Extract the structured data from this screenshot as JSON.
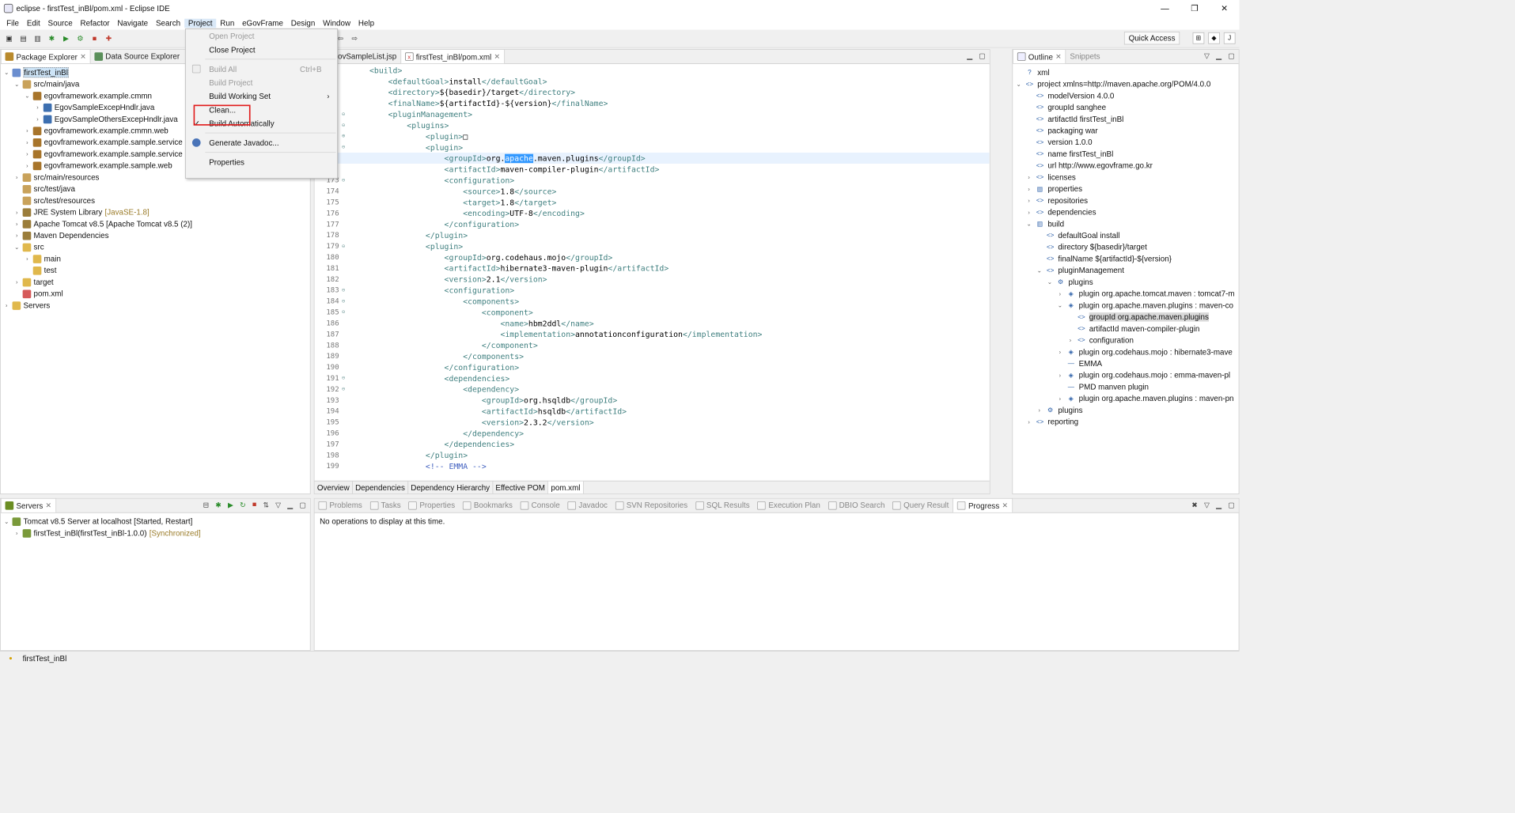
{
  "window": {
    "title": "eclipse - firstTest_inBl/pom.xml - Eclipse IDE",
    "controls": [
      "—",
      "❐",
      "✕"
    ]
  },
  "menubar": [
    "File",
    "Edit",
    "Source",
    "Refactor",
    "Navigate",
    "Search",
    "Project",
    "Run",
    "eGovFrame",
    "Design",
    "Window",
    "Help"
  ],
  "toolbar": {
    "quick_access": "Quick Access"
  },
  "package_explorer": {
    "tabs": [
      "Package Explorer",
      "Data Source Explorer"
    ],
    "tree": [
      {
        "label": "firstTest_inBl",
        "deco": "",
        "indent": 0,
        "twisty": "v",
        "icon": "project-icon",
        "selected": true
      },
      {
        "label": "src/main/java",
        "deco": "",
        "indent": 1,
        "twisty": "v",
        "icon": "source-folder-icon"
      },
      {
        "label": "egovframework.example.cmmn",
        "deco": "",
        "indent": 2,
        "twisty": "v",
        "icon": "package-icon"
      },
      {
        "label": "EgovSampleExcepHndlr.java",
        "deco": "",
        "indent": 3,
        "twisty": ">",
        "icon": "java-file-icon"
      },
      {
        "label": "EgovSampleOthersExcepHndlr.java",
        "deco": "",
        "indent": 3,
        "twisty": ">",
        "icon": "java-file-icon"
      },
      {
        "label": "egovframework.example.cmmn.web",
        "deco": "",
        "indent": 2,
        "twisty": ">",
        "icon": "package-icon"
      },
      {
        "label": "egovframework.example.sample.service",
        "deco": "",
        "indent": 2,
        "twisty": ">",
        "icon": "package-icon"
      },
      {
        "label": "egovframework.example.sample.service",
        "deco": "",
        "indent": 2,
        "twisty": ">",
        "icon": "package-icon"
      },
      {
        "label": "egovframework.example.sample.web",
        "deco": "",
        "indent": 2,
        "twisty": ">",
        "icon": "package-icon"
      },
      {
        "label": "src/main/resources",
        "deco": "",
        "indent": 1,
        "twisty": ">",
        "icon": "source-folder-icon"
      },
      {
        "label": "src/test/java",
        "deco": "",
        "indent": 1,
        "twisty": "",
        "icon": "source-folder-icon"
      },
      {
        "label": "src/test/resources",
        "deco": "",
        "indent": 1,
        "twisty": "",
        "icon": "source-folder-icon"
      },
      {
        "label": "JRE System Library",
        "deco": "[JavaSE-1.8]",
        "indent": 1,
        "twisty": ">",
        "icon": "library-icon"
      },
      {
        "label": "Apache Tomcat v8.5 [Apache Tomcat v8.5 (2)]",
        "deco": "",
        "indent": 1,
        "twisty": ">",
        "icon": "library-icon"
      },
      {
        "label": "Maven Dependencies",
        "deco": "",
        "indent": 1,
        "twisty": ">",
        "icon": "library-icon"
      },
      {
        "label": "src",
        "deco": "",
        "indent": 1,
        "twisty": "v",
        "icon": "folder-icon"
      },
      {
        "label": "main",
        "deco": "",
        "indent": 2,
        "twisty": ">",
        "icon": "folder-icon"
      },
      {
        "label": "test",
        "deco": "",
        "indent": 2,
        "twisty": "",
        "icon": "folder-icon"
      },
      {
        "label": "target",
        "deco": "",
        "indent": 1,
        "twisty": ">",
        "icon": "folder-icon"
      },
      {
        "label": "pom.xml",
        "deco": "",
        "indent": 1,
        "twisty": "",
        "icon": "xml-file-icon"
      },
      {
        "label": "Servers",
        "deco": "",
        "indent": 0,
        "twisty": ">",
        "icon": "folder-icon"
      }
    ]
  },
  "project_menu": {
    "items": [
      {
        "label": "Open Project",
        "disabled": true
      },
      {
        "label": "Close Project",
        "disabled": false
      },
      {
        "sep": true
      },
      {
        "label": "Build All",
        "disabled": true,
        "accel": "Ctrl+B"
      },
      {
        "label": "Build Project",
        "disabled": true
      },
      {
        "label": "Build Working Set",
        "disabled": false,
        "submenu": true
      },
      {
        "label": "Clean...",
        "disabled": false
      },
      {
        "label": "Build Automatically",
        "disabled": false,
        "checked": true
      },
      {
        "sep": true
      },
      {
        "label": "Generate Javadoc...",
        "disabled": false
      },
      {
        "sep": true
      },
      {
        "label": "Properties",
        "disabled": false
      }
    ]
  },
  "editor": {
    "tabs": [
      "ovSampleList.jsp",
      "firstTest_inBl/pom.xml"
    ],
    "lines": [
      {
        "n": "",
        "fold": "",
        "text": "    <build>"
      },
      {
        "n": "",
        "fold": "",
        "text": "        <defaultGoal>install</defaultGoal>"
      },
      {
        "n": "",
        "fold": "",
        "text": "        <directory>${basedir}/target</directory>"
      },
      {
        "n": "",
        "fold": "",
        "text": "        <finalName>${artifactId}-${version}</finalName>"
      },
      {
        "n": "",
        "fold": "⊖",
        "text": "        <pluginManagement>"
      },
      {
        "n": "",
        "fold": "⊖",
        "text": "            <plugins>"
      },
      {
        "n": "",
        "fold": "⊕",
        "text": "                <plugin>□"
      },
      {
        "n": "",
        "fold": "⊖",
        "text": "                <plugin>"
      },
      {
        "n": "",
        "fold": "",
        "text": "                    <groupId>org.apache.maven.plugins</groupId>",
        "hl": true
      },
      {
        "n": "",
        "fold": "",
        "text": "                    <artifactId>maven-compiler-plugin</artifactId>"
      },
      {
        "n": "173",
        "fold": "⊖",
        "text": "                    <configuration>"
      },
      {
        "n": "174",
        "fold": "",
        "text": "                        <source>1.8</source>"
      },
      {
        "n": "175",
        "fold": "",
        "text": "                        <target>1.8</target>"
      },
      {
        "n": "176",
        "fold": "",
        "text": "                        <encoding>UTF-8</encoding>"
      },
      {
        "n": "177",
        "fold": "",
        "text": "                    </configuration>"
      },
      {
        "n": "178",
        "fold": "",
        "text": "                </plugin>"
      },
      {
        "n": "179",
        "fold": "⊖",
        "text": "                <plugin>"
      },
      {
        "n": "180",
        "fold": "",
        "text": "                    <groupId>org.codehaus.mojo</groupId>"
      },
      {
        "n": "181",
        "fold": "",
        "text": "                    <artifactId>hibernate3-maven-plugin</artifactId>"
      },
      {
        "n": "182",
        "fold": "",
        "text": "                    <version>2.1</version>"
      },
      {
        "n": "183",
        "fold": "⊖",
        "text": "                    <configuration>"
      },
      {
        "n": "184",
        "fold": "⊖",
        "text": "                        <components>"
      },
      {
        "n": "185",
        "fold": "⊖",
        "text": "                            <component>"
      },
      {
        "n": "186",
        "fold": "",
        "text": "                                <name>hbm2ddl</name>"
      },
      {
        "n": "187",
        "fold": "",
        "text": "                                <implementation>annotationconfiguration</implementation>"
      },
      {
        "n": "188",
        "fold": "",
        "text": "                            </component>"
      },
      {
        "n": "189",
        "fold": "",
        "text": "                        </components>"
      },
      {
        "n": "190",
        "fold": "",
        "text": "                    </configuration>"
      },
      {
        "n": "191",
        "fold": "⊖",
        "text": "                    <dependencies>"
      },
      {
        "n": "192",
        "fold": "⊖",
        "text": "                        <dependency>"
      },
      {
        "n": "193",
        "fold": "",
        "text": "                            <groupId>org.hsqldb</groupId>"
      },
      {
        "n": "194",
        "fold": "",
        "text": "                            <artifactId>hsqldb</artifactId>"
      },
      {
        "n": "195",
        "fold": "",
        "text": "                            <version>2.3.2</version>"
      },
      {
        "n": "196",
        "fold": "",
        "text": "                        </dependency>"
      },
      {
        "n": "197",
        "fold": "",
        "text": "                    </dependencies>"
      },
      {
        "n": "198",
        "fold": "",
        "text": "                </plugin>"
      },
      {
        "n": "199",
        "fold": "",
        "text": "                <!-- EMMA -->"
      }
    ],
    "highlight_word": "apache",
    "bottom_tabs": [
      "Overview",
      "Dependencies",
      "Dependency Hierarchy",
      "Effective POM",
      "pom.xml"
    ]
  },
  "outline": {
    "tabs": [
      "Outline",
      "Snippets"
    ],
    "tree": [
      {
        "label": "xml",
        "indent": 0,
        "twisty": "",
        "icon": "?"
      },
      {
        "label": "project xmlns=http://maven.apache.org/POM/4.0.0",
        "indent": 0,
        "twisty": "v",
        "icon": "<>"
      },
      {
        "label": "modelVersion  4.0.0",
        "indent": 1,
        "twisty": "",
        "icon": "<>"
      },
      {
        "label": "groupId  sanghee",
        "indent": 1,
        "twisty": "",
        "icon": "<>"
      },
      {
        "label": "artifactId  firstTest_inBl",
        "indent": 1,
        "twisty": "",
        "icon": "<>"
      },
      {
        "label": "packaging  war",
        "indent": 1,
        "twisty": "",
        "icon": "<>"
      },
      {
        "label": "version  1.0.0",
        "indent": 1,
        "twisty": "",
        "icon": "<>"
      },
      {
        "label": "name  firstTest_inBl",
        "indent": 1,
        "twisty": "",
        "icon": "<>"
      },
      {
        "label": "url  http://www.egovframe.go.kr",
        "indent": 1,
        "twisty": "",
        "icon": "<>"
      },
      {
        "label": "licenses",
        "indent": 1,
        "twisty": ">",
        "icon": "<>"
      },
      {
        "label": "properties",
        "indent": 1,
        "twisty": ">",
        "icon": "▤"
      },
      {
        "label": "repositories",
        "indent": 1,
        "twisty": ">",
        "icon": "<>"
      },
      {
        "label": "dependencies",
        "indent": 1,
        "twisty": ">",
        "icon": "<>"
      },
      {
        "label": "build",
        "indent": 1,
        "twisty": "v",
        "icon": "▥"
      },
      {
        "label": "defaultGoal  install",
        "indent": 2,
        "twisty": "",
        "icon": "<>"
      },
      {
        "label": "directory  ${basedir}/target",
        "indent": 2,
        "twisty": "",
        "icon": "<>"
      },
      {
        "label": "finalName  ${artifactId}-${version}",
        "indent": 2,
        "twisty": "",
        "icon": "<>"
      },
      {
        "label": "pluginManagement",
        "indent": 2,
        "twisty": "v",
        "icon": "<>"
      },
      {
        "label": "plugins",
        "indent": 3,
        "twisty": "v",
        "icon": "⚙"
      },
      {
        "label": "plugin  org.apache.tomcat.maven : tomcat7-m",
        "indent": 4,
        "twisty": ">",
        "icon": "◈"
      },
      {
        "label": "plugin  org.apache.maven.plugins : maven-co",
        "indent": 4,
        "twisty": "v",
        "icon": "◈"
      },
      {
        "label": "groupId  org.apache.maven.plugins",
        "indent": 5,
        "twisty": "",
        "icon": "<>",
        "selected": true
      },
      {
        "label": "artifactId  maven-compiler-plugin",
        "indent": 5,
        "twisty": "",
        "icon": "<>"
      },
      {
        "label": "configuration",
        "indent": 5,
        "twisty": ">",
        "icon": "<>"
      },
      {
        "label": "plugin  org.codehaus.mojo : hibernate3-mave",
        "indent": 4,
        "twisty": ">",
        "icon": "◈"
      },
      {
        "label": "EMMA",
        "indent": 4,
        "twisty": "",
        "icon": "—"
      },
      {
        "label": "plugin  org.codehaus.mojo : emma-maven-pl",
        "indent": 4,
        "twisty": ">",
        "icon": "◈"
      },
      {
        "label": "PMD manven plugin",
        "indent": 4,
        "twisty": "",
        "icon": "—"
      },
      {
        "label": "plugin  org.apache.maven.plugins : maven-pn",
        "indent": 4,
        "twisty": ">",
        "icon": "◈"
      },
      {
        "label": "plugins",
        "indent": 2,
        "twisty": ">",
        "icon": "⚙"
      },
      {
        "label": "reporting",
        "indent": 1,
        "twisty": ">",
        "icon": "<>"
      }
    ]
  },
  "servers": {
    "tab": "Servers",
    "tree": [
      {
        "label": "Tomcat v8.5 Server at localhost  [Started, Restart]",
        "deco": "",
        "indent": 0,
        "twisty": "v"
      },
      {
        "label": "firstTest_inBl(firstTest_inBl-1.0.0)",
        "deco": "[Synchronized]",
        "indent": 1,
        "twisty": ">"
      }
    ]
  },
  "bottom_views": {
    "tabs": [
      "Problems",
      "Tasks",
      "Properties",
      "Bookmarks",
      "Console",
      "Javadoc",
      "SVN Repositories",
      "SQL Results",
      "Execution Plan",
      "DBIO Search",
      "Query Result",
      "Progress"
    ],
    "active": "Progress",
    "message": "No operations to display at this time."
  },
  "status": {
    "text": "firstTest_inBl"
  },
  "colors": {
    "highlight": "#3399ff",
    "annotation_box": "#e11b1b",
    "selection": "#cde4f7"
  }
}
